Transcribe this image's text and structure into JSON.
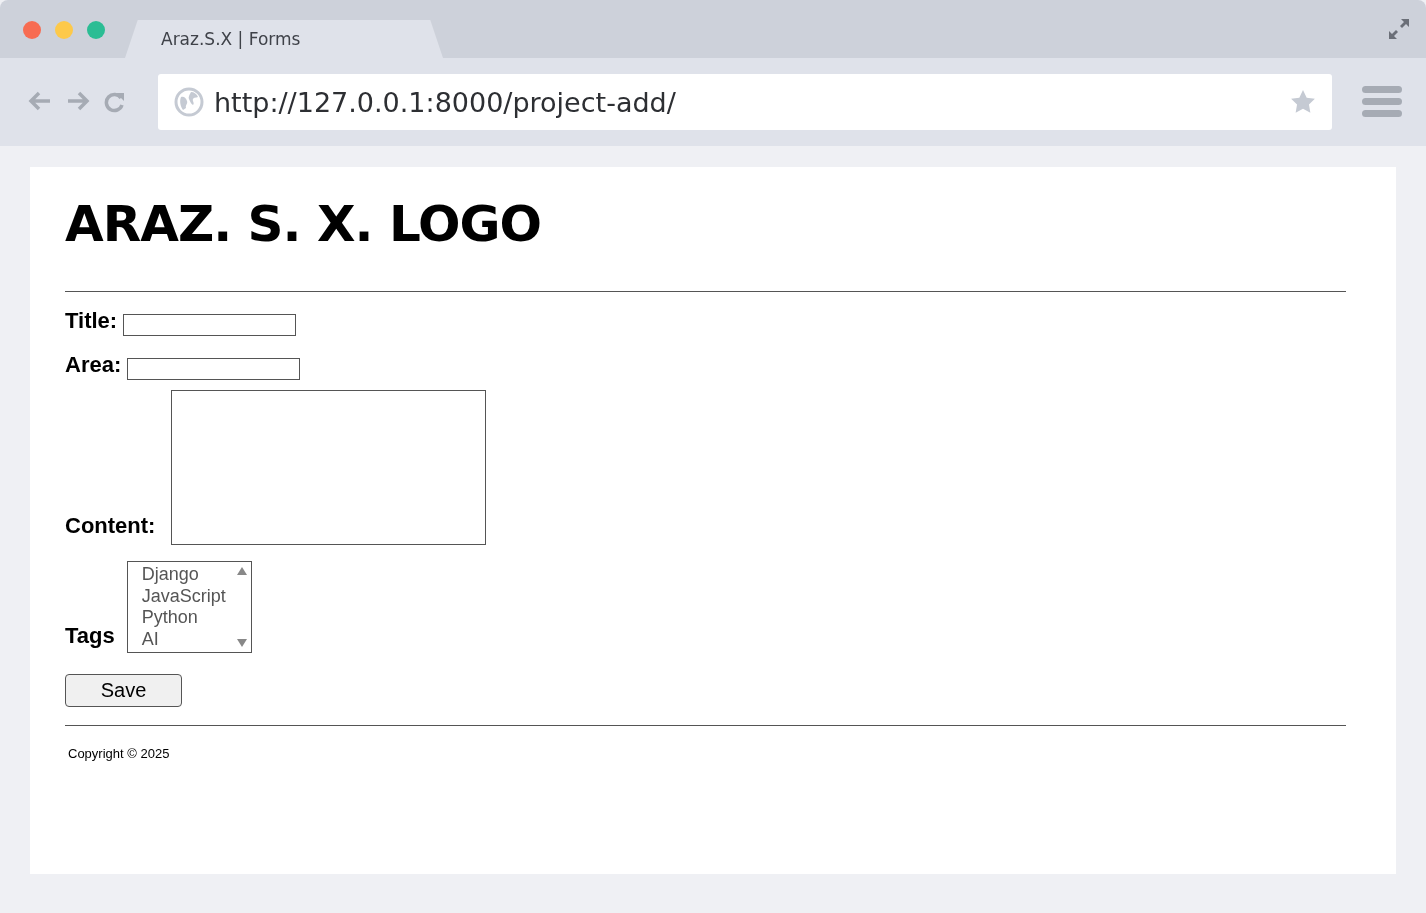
{
  "window": {
    "tab_title": "Araz.S.X | Forms",
    "url": "http://127.0.0.1:8000/project-add/"
  },
  "page": {
    "heading": "ARAZ. S. X. LOGO",
    "form": {
      "fields": [
        {
          "kind": "input",
          "label": "Title:"
        },
        {
          "kind": "input",
          "label": "Area:"
        },
        {
          "kind": "textarea",
          "label": "Content:"
        },
        {
          "kind": "multiselect",
          "label": "Tags",
          "options": [
            {
              "label": "Django",
              "selected": false
            },
            {
              "label": "JavaScript",
              "selected": false
            },
            {
              "label": "Python",
              "selected": false
            },
            {
              "label": "AI",
              "selected": false
            }
          ]
        }
      ],
      "submit": "Save"
    },
    "footer": {
      "copyright": "Copyright © 2025"
    }
  }
}
